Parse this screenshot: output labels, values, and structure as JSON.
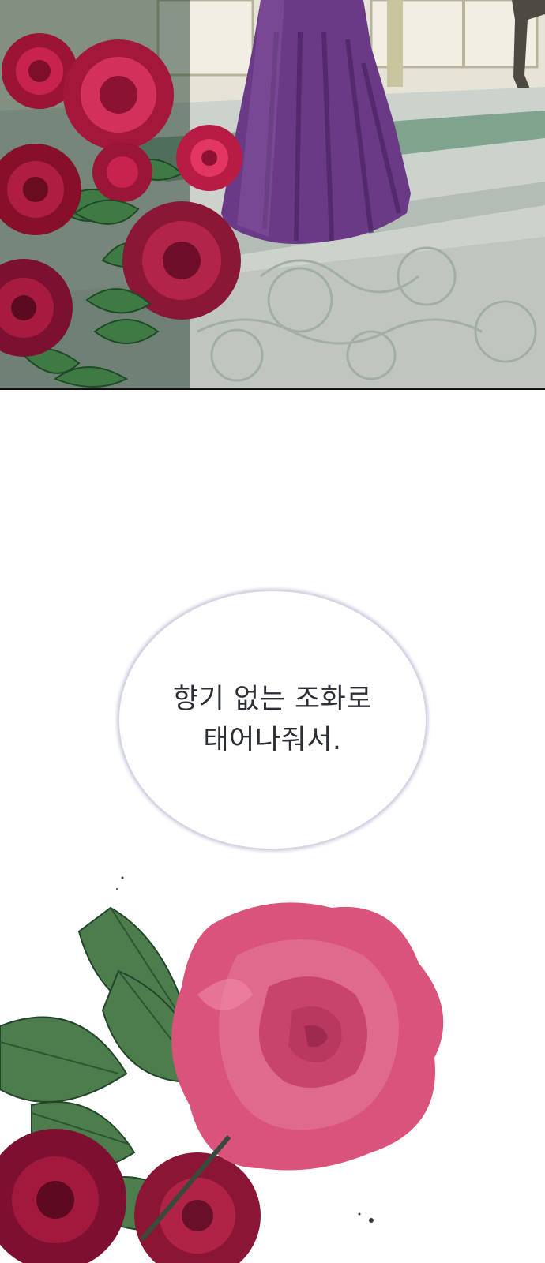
{
  "panels": {
    "top_panel": {
      "scene": "roses-and-purple-gown"
    },
    "speech_bubble": {
      "lines": [
        "향기 없는 조화로",
        "태어나줘서."
      ]
    },
    "bottom_panel": {
      "scene": "rose-closeup"
    }
  },
  "colors": {
    "rose": "#c8224e",
    "rose_light": "#e06a8e",
    "leaf": "#4b7a4a",
    "gown": "#6a3a86",
    "floor": "#c9cfca"
  }
}
